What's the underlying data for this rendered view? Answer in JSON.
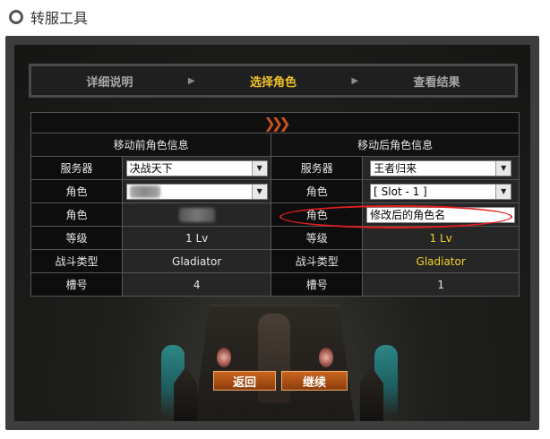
{
  "header": {
    "title": "转服工具"
  },
  "steps": [
    {
      "label": "详细说明",
      "active": false
    },
    {
      "label": "选择角色",
      "active": true
    },
    {
      "label": "查看结果",
      "active": false
    }
  ],
  "table": {
    "before_header": "移动前角色信息",
    "after_header": "移动后角色信息",
    "rows": {
      "server": {
        "label": "服务器",
        "before": "决战天下",
        "after": "王者归来"
      },
      "character_select": {
        "label": "角色",
        "before": "",
        "after": "[ Slot - 1 ]"
      },
      "character_name": {
        "label": "角色",
        "before": "",
        "after": "修改后的角色名"
      },
      "level": {
        "label": "等级",
        "before": "1 Lv",
        "after": "1 Lv"
      },
      "class": {
        "label": "战斗类型",
        "before": "Gladiator",
        "after": "Gladiator"
      },
      "slot": {
        "label": "槽号",
        "before": "4",
        "after": "1"
      }
    }
  },
  "buttons": {
    "back": "返回",
    "continue": "继续"
  },
  "colors": {
    "active_step": "#f0c22a",
    "header_red": "#e24a2a",
    "highlight_yellow": "#f4d22a",
    "button_orange": "#c9651d",
    "annotation_red": "#e21f1f"
  }
}
